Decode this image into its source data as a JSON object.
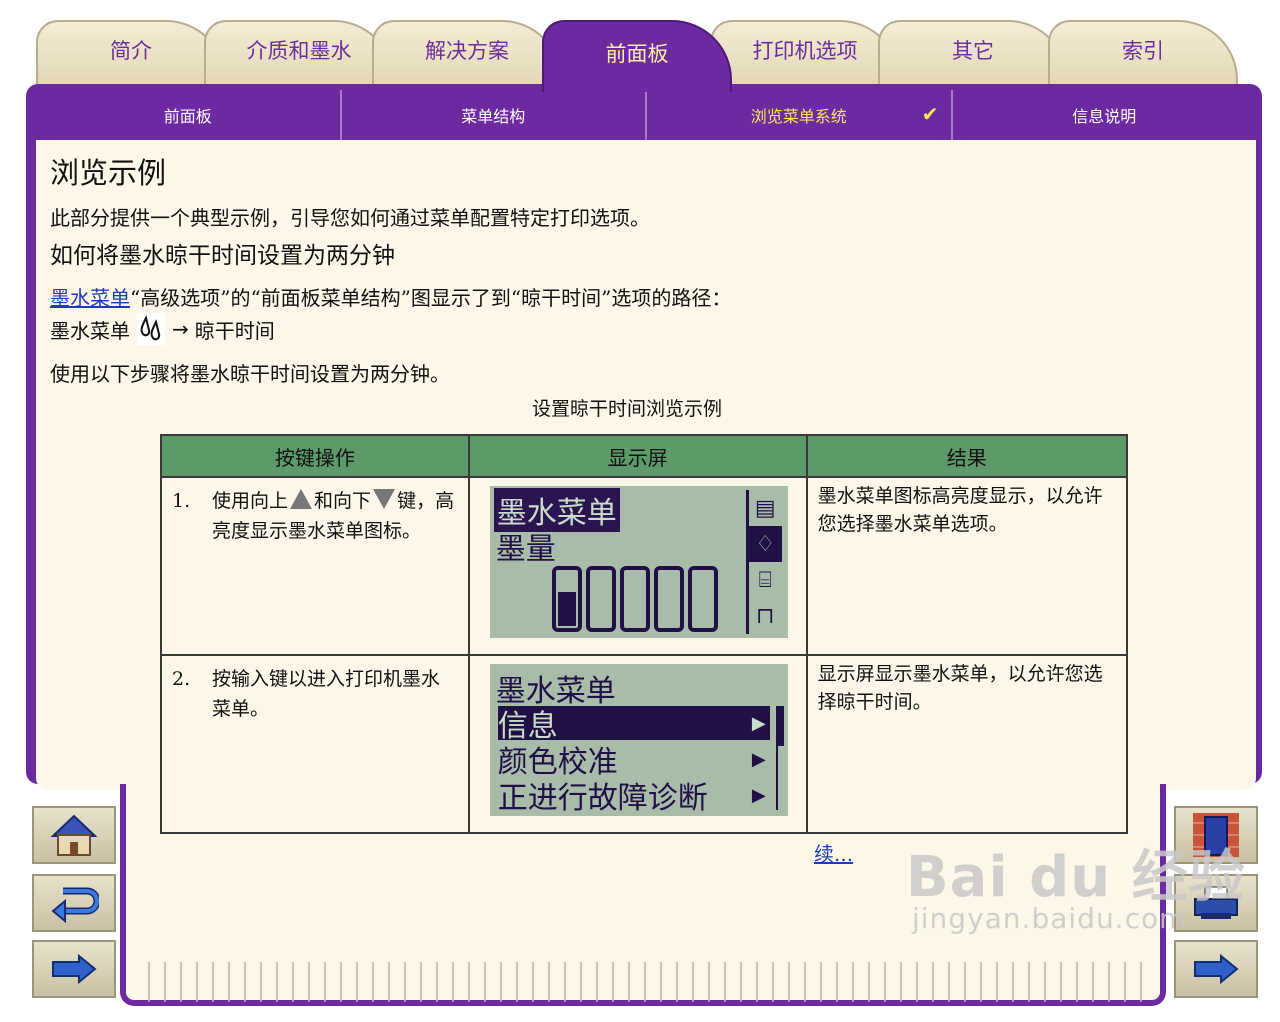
{
  "tabs": [
    {
      "label": "简介",
      "active": false
    },
    {
      "label": "介质和墨水",
      "active": false
    },
    {
      "label": "解决方案",
      "active": false
    },
    {
      "label": "前面板",
      "active": true
    },
    {
      "label": "打印机选项",
      "active": false
    },
    {
      "label": "其它",
      "active": false
    },
    {
      "label": "索引",
      "active": false
    }
  ],
  "subnav": [
    {
      "label": "前面板",
      "active": false
    },
    {
      "label": "菜单结构",
      "active": false
    },
    {
      "label": "浏览菜单系统",
      "active": true,
      "check": "✔"
    },
    {
      "label": "信息说明",
      "active": false
    }
  ],
  "content": {
    "title": "浏览示例",
    "intro": "此部分提供一个典型示例，引导您如何通过菜单配置特定打印选项。",
    "subtitle": "如何将墨水晾干时间设置为两分钟",
    "path_link": "墨水菜单",
    "path_text": "“高级选项”的“前面板菜单结构”图显示了到“晾干时间”选项的路径：",
    "path_start": "墨水菜单",
    "path_arrow": "→",
    "path_end": "晾干时间",
    "steps_intro": "使用以下步骤将墨水晾干时间设置为两分钟。",
    "table_caption": "设置晾干时间浏览示例"
  },
  "table": {
    "headers": [
      "按键操作",
      "显示屏",
      "结果"
    ],
    "rows": [
      {
        "num": "1.",
        "action_a": "使用",
        "action_b": "向上",
        "action_c": "和",
        "action_d": "向下",
        "action_e": "键，高亮度显示",
        "action_f": "墨水",
        "action_g": "菜单图标。",
        "result_a": "墨水",
        "result_b": "菜单图标高亮度显示，以允许您选择",
        "result_c": "墨水",
        "result_d": "菜单选项。"
      },
      {
        "num": "2.",
        "action_a": "按",
        "action_b": "输入",
        "action_c": "键以进入打印机",
        "action_d": "墨水",
        "action_e": "菜单。",
        "result_a": "显示屏显示",
        "result_b": "墨水",
        "result_c": "菜单，以允许您选择晾干时间。"
      }
    ]
  },
  "lcd1": {
    "title": "墨水菜单",
    "line2": "墨量"
  },
  "lcd2": {
    "title": "墨水菜单",
    "items": [
      "信息",
      "颜色校准",
      "正进行故障诊断"
    ]
  },
  "continue_link": "续...",
  "watermark": {
    "brand": "Bai du 经验",
    "url": "jingyan.baidu.com"
  },
  "colors": {
    "accent": "#6d2aa0",
    "panel": "#fcf7e8",
    "table_header": "#5c9a6a",
    "lcd": "#a9bba9"
  }
}
